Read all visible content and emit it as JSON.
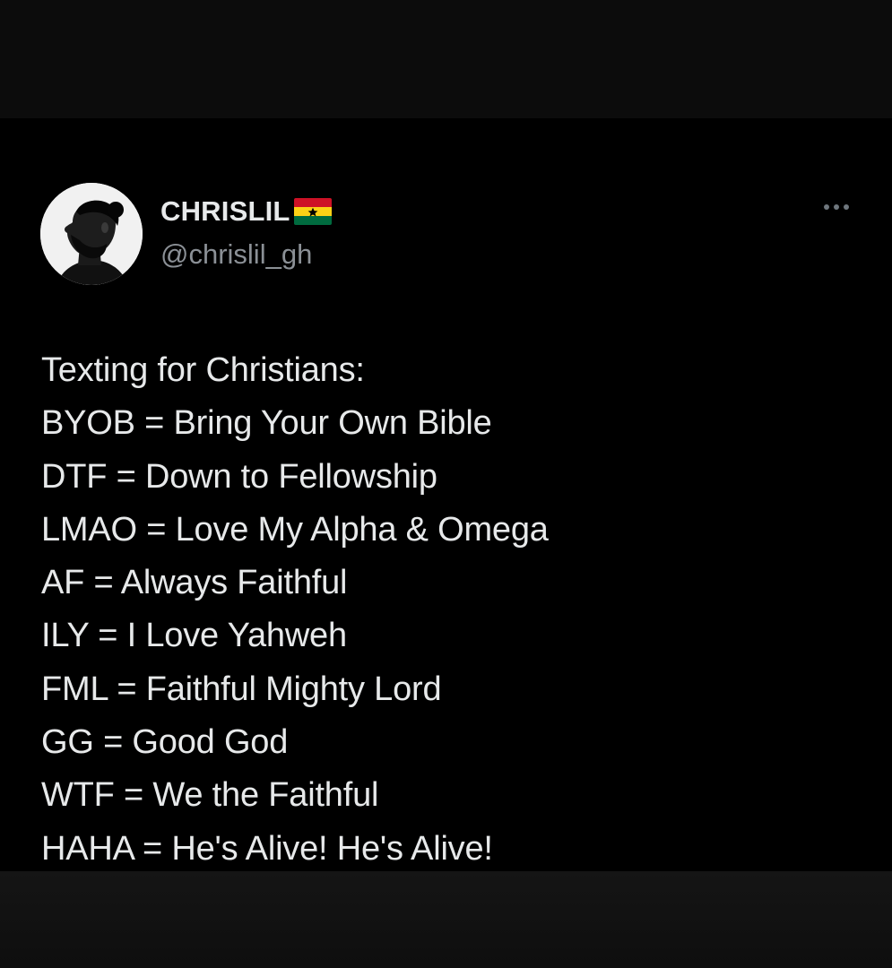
{
  "tweet": {
    "author": {
      "display_name": "CHRISLIL",
      "flag_icon": "ghana-flag-icon",
      "handle": "@chrislil_gh"
    },
    "more_icon": "more-horizontal-icon",
    "lines": [
      "Texting for Christians:",
      "BYOB = Bring Your Own Bible",
      "DTF = Down to Fellowship",
      "LMAO = Love My Alpha & Omega",
      "AF = Always Faithful",
      "ILY = I Love Yahweh",
      "FML = Faithful Mighty Lord",
      "GG = Good God",
      "WTF = We the Faithful",
      "HAHA = He's Alive! He's Alive!"
    ]
  },
  "colors": {
    "background": "#000000",
    "text_primary": "#e7e9ea",
    "text_secondary": "#8b9096",
    "flag_red": "#ce1126",
    "flag_gold": "#fcd116",
    "flag_green": "#006b3f",
    "flag_star": "#000000"
  }
}
